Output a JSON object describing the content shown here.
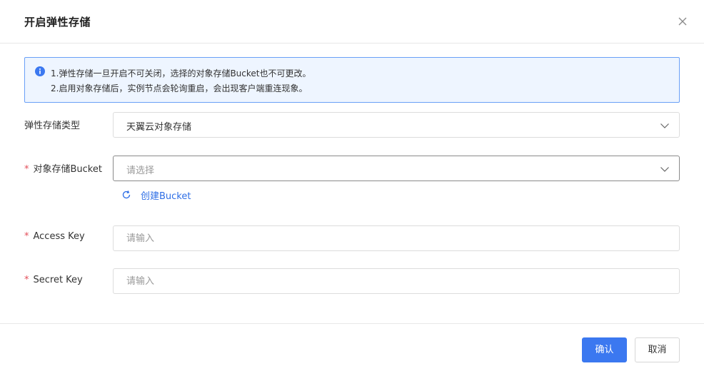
{
  "dialog": {
    "title": "开启弹性存储"
  },
  "notice": {
    "line1": "1.弹性存储一旦开启不可关闭，选择的对象存储Bucket也不可更改。",
    "line2": "2.启用对象存储后，实例节点会轮询重启，会出现客户端重连现象。",
    "icon": "info-icon"
  },
  "form": {
    "storage_type": {
      "label": "弹性存储类型",
      "value": "天翼云对象存储"
    },
    "bucket": {
      "label": "对象存储Bucket",
      "required_mark": "*",
      "placeholder": "请选择",
      "create_link": "创建Bucket"
    },
    "access_key": {
      "label": "Access Key",
      "required_mark": "*",
      "placeholder": "请输入"
    },
    "secret_key": {
      "label": "Secret Key",
      "required_mark": "*",
      "placeholder": "请输入"
    }
  },
  "footer": {
    "confirm_label": "确认",
    "cancel_label": "取消"
  },
  "colors": {
    "primary": "#3b78f0",
    "notice_bg": "#eef5ff",
    "notice_border": "#6aa0f7",
    "required": "#e34d59",
    "link": "#2f6fe6"
  }
}
